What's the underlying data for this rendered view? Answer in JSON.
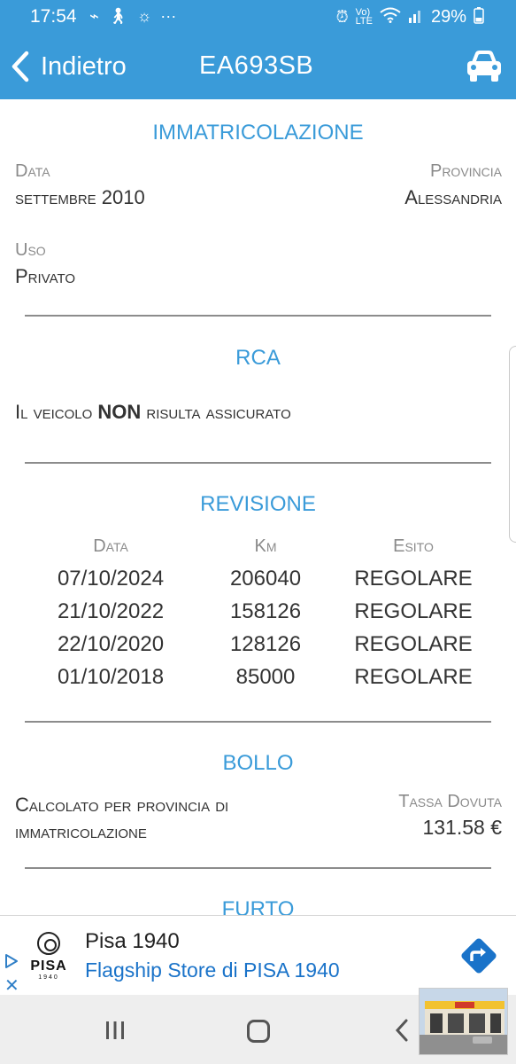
{
  "status_bar": {
    "time": "17:54",
    "battery": "29%"
  },
  "app_bar": {
    "back_label": "Indietro",
    "title": "EA693SB",
    "car_icon": "car-icon"
  },
  "immatricolazione": {
    "title": "IMMATRICOLAZIONE",
    "data_label": "Data",
    "data_value": "settembre 2010",
    "provincia_label": "Provincia",
    "provincia_value": "Alessandria",
    "uso_label": "Uso",
    "uso_value": "Privato"
  },
  "rca": {
    "title": "RCA",
    "text_before": "Il veicolo ",
    "text_bold": "NON",
    "text_after": " risulta assicurato"
  },
  "revisione": {
    "title": "REVISIONE",
    "headers": [
      "Data",
      "Km",
      "Esito"
    ],
    "rows": [
      [
        "07/10/2024",
        "206040",
        "REGOLARE"
      ],
      [
        "21/10/2022",
        "158126",
        "REGOLARE"
      ],
      [
        "22/10/2020",
        "128126",
        "REGOLARE"
      ],
      [
        "01/10/2018",
        "85000",
        "REGOLARE"
      ]
    ]
  },
  "bollo": {
    "title": "BOLLO",
    "desc_line1": "Calcolato per provincia di",
    "desc_line2": "immatricolazione",
    "tassa_label": "Tassa Dovuta",
    "tassa_value": "131.58 €"
  },
  "furto": {
    "title": "FURTO"
  },
  "ad": {
    "logo_text": "PISA",
    "logo_sub": "1940",
    "title": "Pisa 1940",
    "subtitle": "Flagship Store di PISA 1940",
    "close": "✕"
  },
  "colors": {
    "accent": "#3a9bd9",
    "ad_link": "#1a73c9"
  }
}
